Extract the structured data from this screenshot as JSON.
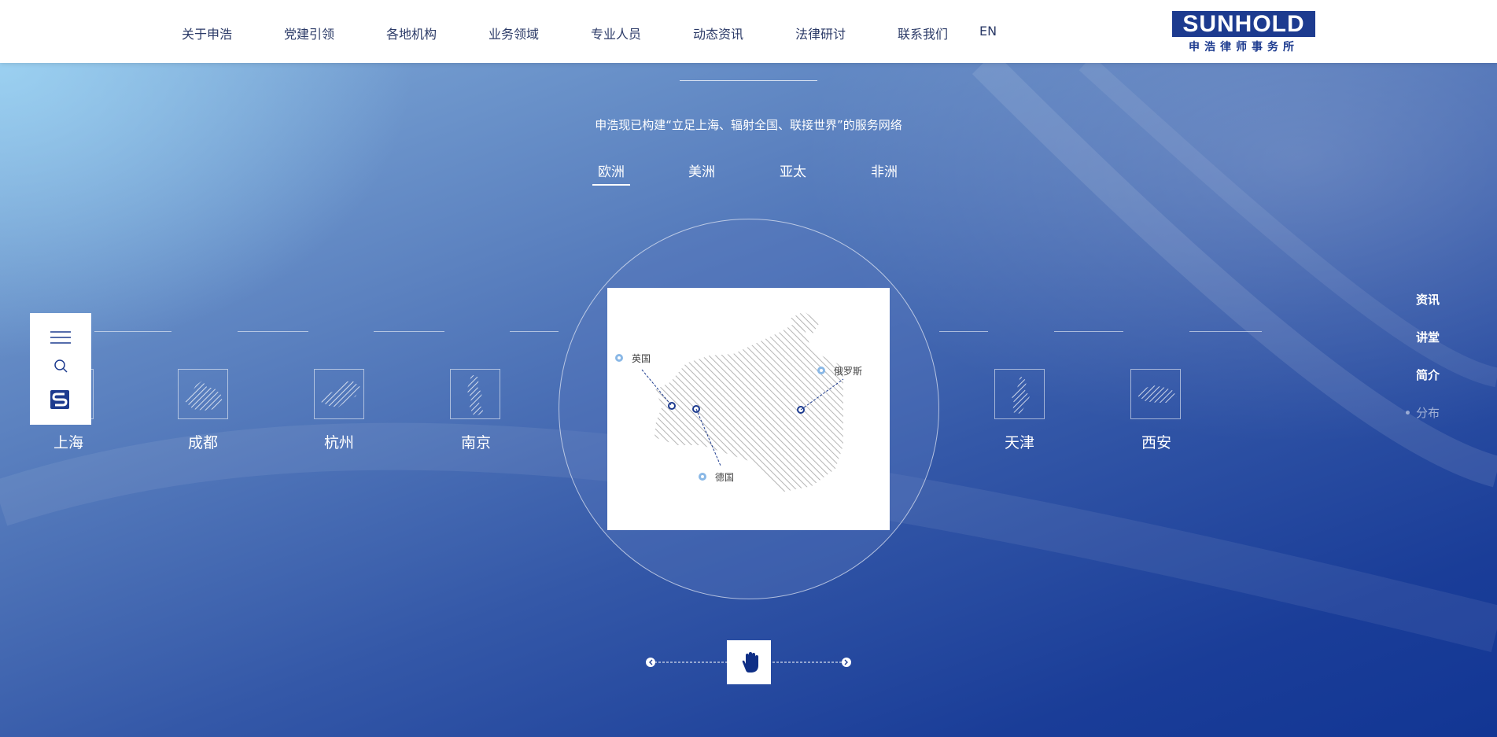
{
  "nav": {
    "items": [
      "关于申浩",
      "党建引领",
      "各地机构",
      "业务领域",
      "专业人员",
      "动态资讯",
      "法律研讨",
      "联系我们"
    ],
    "lang": "EN"
  },
  "logo": {
    "name": "SUNHOLD",
    "subtitle": "申浩律师事务所"
  },
  "hero": {
    "subtitle": "申浩现已构建“立足上海、辐射全国、联接世界”的服务网络",
    "tabs": [
      "欧洲",
      "美洲",
      "亚太",
      "非洲"
    ],
    "active_tab": "欧洲"
  },
  "cities_left": [
    "上海",
    "成都",
    "杭州",
    "南京"
  ],
  "cities_right": [
    "天津",
    "西安"
  ],
  "map_labels": [
    "英国",
    "俄罗斯",
    "德国"
  ],
  "right_nav": {
    "items": [
      "资讯",
      "讲堂",
      "简介",
      "分布"
    ],
    "active": "分布"
  },
  "icons": [
    "menu-icon",
    "search-icon",
    "sunhold-logo-icon",
    "hand-icon",
    "chevron-left-icon",
    "chevron-right-icon"
  ],
  "colors": {
    "brand": "#1d3b8f",
    "nav_text": "#2b3a67",
    "hero_dark": "#123694"
  }
}
